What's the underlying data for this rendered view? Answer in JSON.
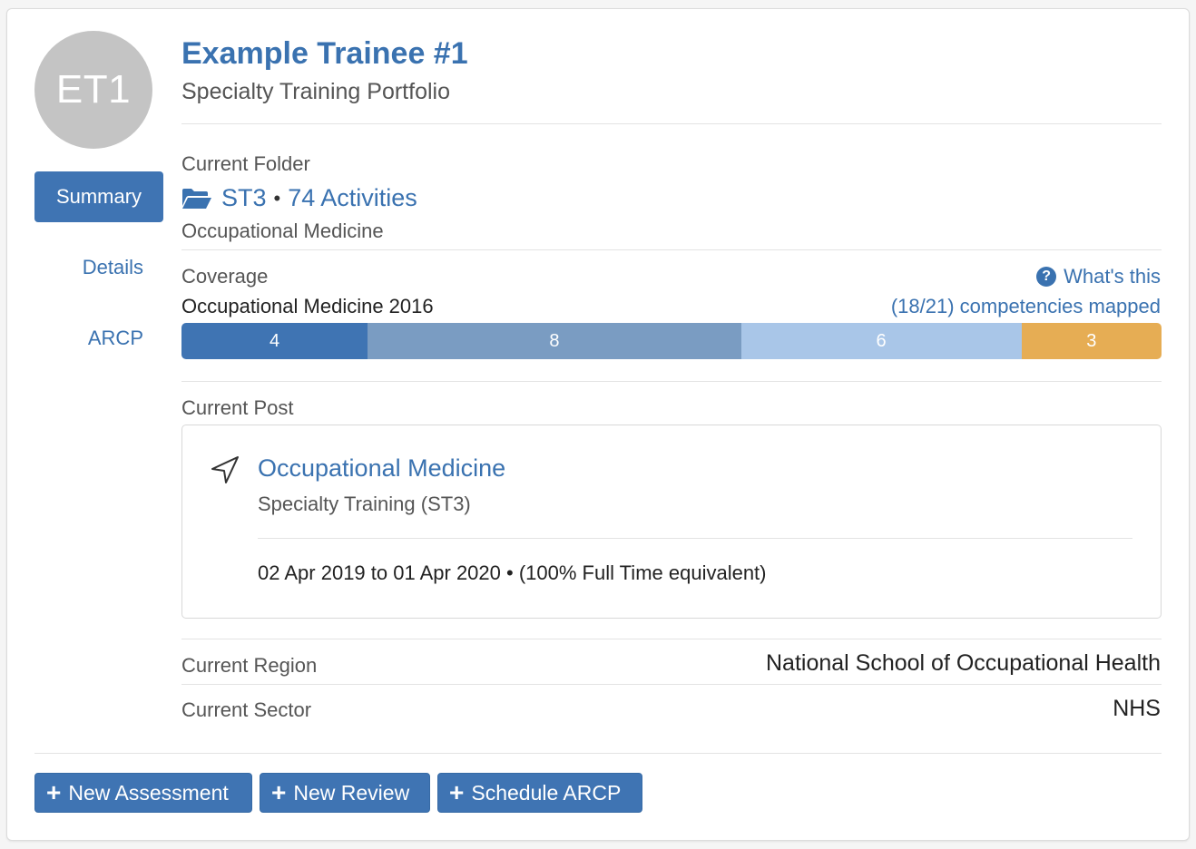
{
  "trainee": {
    "initials": "ET1",
    "name": "Example Trainee #1",
    "portfolio": "Specialty Training Portfolio"
  },
  "nav": {
    "summary": "Summary",
    "details": "Details",
    "arcp": "ARCP"
  },
  "folder": {
    "label": "Current Folder",
    "name": "ST3",
    "separator": "•",
    "activities": "74 Activities",
    "specialty": "Occupational Medicine",
    "icon": "folder-open-icon"
  },
  "coverage": {
    "label": "Coverage",
    "help": "What's this",
    "curriculum": "Occupational Medicine 2016",
    "mapped": "(18/21) competencies mapped",
    "segments": [
      {
        "value": "4",
        "color": "#3f74b3",
        "fraction": 0.19
      },
      {
        "value": "8",
        "color": "#7a9cc2",
        "fraction": 0.381
      },
      {
        "value": "6",
        "color": "#a9c6e8",
        "fraction": 0.286
      },
      {
        "value": "3",
        "color": "#e6ad54",
        "fraction": 0.143
      }
    ]
  },
  "post": {
    "label": "Current Post",
    "title": "Occupational Medicine",
    "grade": "Specialty Training (ST3)",
    "dates": "02 Apr 2019 to 01 Apr 2020 • (100% Full Time equivalent)",
    "icon": "location-arrow-icon"
  },
  "region": {
    "label": "Current Region",
    "value": "National School of Occupational Health"
  },
  "sector": {
    "label": "Current Sector",
    "value": "NHS"
  },
  "actions": {
    "new_assessment": "New Assessment",
    "new_review": "New Review",
    "schedule_arcp": "Schedule ARCP"
  }
}
